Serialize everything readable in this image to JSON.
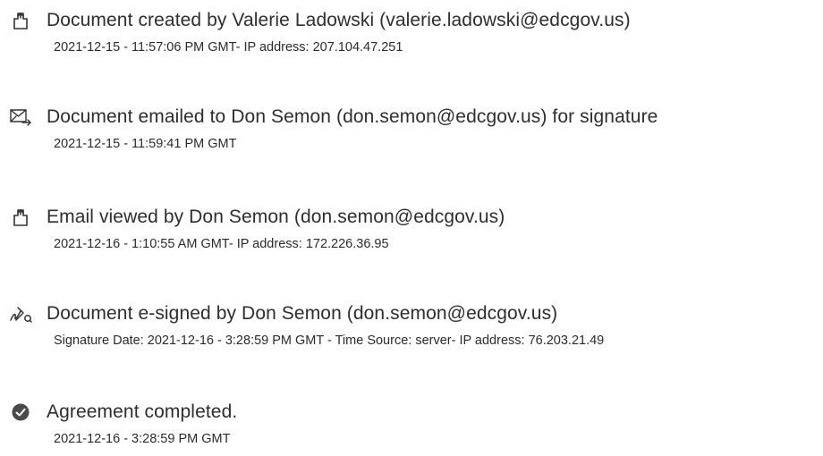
{
  "events": [
    {
      "icon": "document-created-icon",
      "title": "Document created by Valerie Ladowski (valerie.ladowski@edcgov.us)",
      "detail": "2021-12-15 - 11:57:06 PM GMT- IP address: 207.104.47.251"
    },
    {
      "icon": "document-emailed-icon",
      "title": "Document emailed to Don Semon (don.semon@edcgov.us) for signature",
      "detail": "2021-12-15 - 11:59:41 PM GMT"
    },
    {
      "icon": "email-viewed-icon",
      "title": "Email viewed by Don Semon (don.semon@edcgov.us)",
      "detail": "2021-12-16 - 1:10:55 AM GMT- IP address: 172.226.36.95"
    },
    {
      "icon": "e-signed-icon",
      "title": "Document e-signed by Don Semon (don.semon@edcgov.us)",
      "detail": "Signature Date: 2021-12-16 - 3:28:59 PM GMT - Time Source: server- IP address: 76.203.21.49"
    },
    {
      "icon": "agreement-completed-icon",
      "title": "Agreement completed.",
      "detail": "2021-12-16 - 3:28:59 PM GMT"
    }
  ]
}
